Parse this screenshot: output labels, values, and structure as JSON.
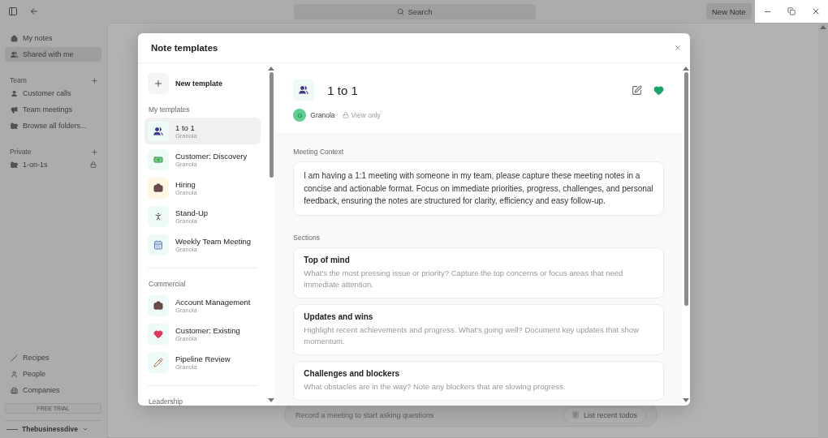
{
  "top_bar": {
    "search": {
      "placeholder": "Search"
    },
    "new_note_button": "New Note"
  },
  "sidebar": {
    "nav": [
      {
        "label": "My notes",
        "selected": false
      },
      {
        "label": "Shared with me",
        "selected": true
      }
    ],
    "sections": [
      {
        "title": "Team",
        "items": [
          {
            "label": "Customer calls",
            "locked": false
          },
          {
            "label": "Team meetings",
            "locked": false
          },
          {
            "label": "Browse all folders...",
            "locked": false
          }
        ]
      },
      {
        "title": "Private",
        "items": [
          {
            "label": "1-on-1s",
            "locked": true
          }
        ]
      }
    ],
    "bottom_links": [
      "Recipes",
      "People",
      "Companies"
    ],
    "trial_button": "FREE TRIAL",
    "user": "Thebusinessdive"
  },
  "main": {
    "ask_field": {
      "placeholder": "Record a meeting to start asking questions"
    },
    "suggestion": {
      "key": "/",
      "label": "List recent todos"
    }
  },
  "modal": {
    "title": "Note templates",
    "new_template": "New template",
    "groups": [
      {
        "title": "My templates",
        "templates": [
          {
            "name": "1 to 1",
            "author": "Granola",
            "selected": true
          },
          {
            "name": "Customer: Discovery",
            "author": "Granola",
            "selected": false
          },
          {
            "name": "Hiring",
            "author": "Granola",
            "selected": false
          },
          {
            "name": "Stand-Up",
            "author": "Granola",
            "selected": false
          },
          {
            "name": "Weekly Team Meeting",
            "author": "Granola",
            "selected": false
          }
        ]
      },
      {
        "title": "Commercial",
        "templates": [
          {
            "name": "Account Management",
            "author": "Granola",
            "selected": false
          },
          {
            "name": "Customer: Existing",
            "author": "Granola",
            "selected": false
          },
          {
            "name": "Pipeline Review",
            "author": "Granola",
            "selected": false
          }
        ]
      },
      {
        "title": "Leadership"
      }
    ],
    "detail": {
      "title": "1 to 1",
      "author": {
        "initial": "G",
        "name": "Granola"
      },
      "access": "View only",
      "favorite": true,
      "context_label": "Meeting Context",
      "context": "I am having a 1:1 meeting with someone in my team, please capture these meeting notes in a concise and actionable format. Focus on immediate priorities, progress, challenges, and personal feedback, ensuring the notes are structured for clarity, efficiency and easy follow-up.",
      "sections_label": "Sections",
      "sections": [
        {
          "title": "Top of mind",
          "description": "What's the most pressing issue or priority? Capture the top concerns or focus areas that need immediate attention."
        },
        {
          "title": "Updates and wins",
          "description": "Highlight recent achievements and progress. What's going well? Document key updates that show momentum."
        },
        {
          "title": "Challenges and blockers",
          "description": "What obstacles are in the way? Note any blockers that are slowing progress."
        }
      ]
    }
  }
}
